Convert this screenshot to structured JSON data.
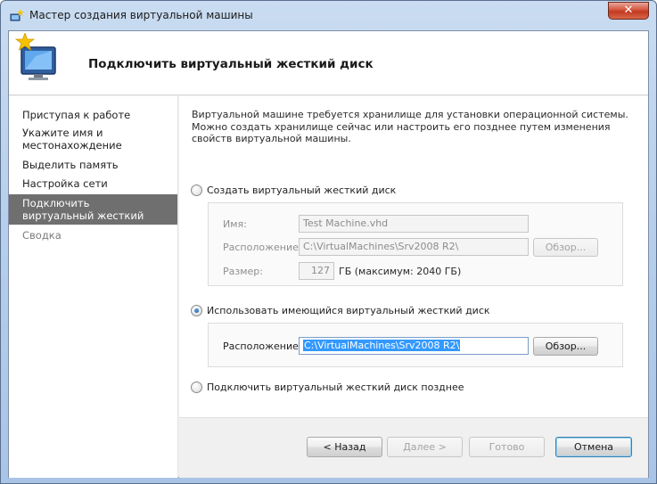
{
  "window": {
    "title": "Мастер создания виртуальной машины",
    "close_symbol": "✕"
  },
  "header": {
    "title": "Подключить виртуальный жесткий диск",
    "icon": "new-vm-monitor-icon"
  },
  "sidebar": {
    "items": [
      {
        "label": "Приступая к работе",
        "state": "normal"
      },
      {
        "label": "Укажите имя и местонахождение",
        "state": "normal"
      },
      {
        "label": "Выделить память",
        "state": "normal"
      },
      {
        "label": "Настройка сети",
        "state": "normal"
      },
      {
        "label": "Подключить виртуальный жесткий диск",
        "state": "active"
      },
      {
        "label": "Сводка",
        "state": "disabled"
      }
    ]
  },
  "main": {
    "description": "Виртуальной машине требуется хранилище для установки операционной системы. Можно создать хранилище сейчас или настроить его позднее путем изменения свойств виртуальной машины.",
    "create_option": {
      "label": "Создать виртуальный жесткий диск",
      "selected": false,
      "name_label": "Имя:",
      "name_value": "Test Machine.vhd",
      "location_label": "Расположение:",
      "location_value": "C:\\VirtualMachines\\Srv2008 R2\\",
      "browse_label": "Обзор...",
      "size_label": "Размер:",
      "size_value": "127",
      "size_unit": "ГБ (максимум: 2040 ГБ)"
    },
    "use_existing_option": {
      "label": "Использовать имеющийся виртуальный жесткий диск",
      "selected": true,
      "location_label": "Расположение:",
      "location_value": "C:\\VirtualMachines\\Srv2008 R2\\",
      "browse_label": "Обзор..."
    },
    "attach_later_option": {
      "label": "Подключить виртуальный жесткий диск позднее",
      "selected": false
    }
  },
  "footer": {
    "back_label": "< Назад",
    "next_label": "Далее >",
    "finish_label": "Готово",
    "cancel_label": "Отмена"
  },
  "colors": {
    "active_nav_bg": "#6f6f6f",
    "selection": "#3399ff",
    "close_button": "#c23a20"
  }
}
